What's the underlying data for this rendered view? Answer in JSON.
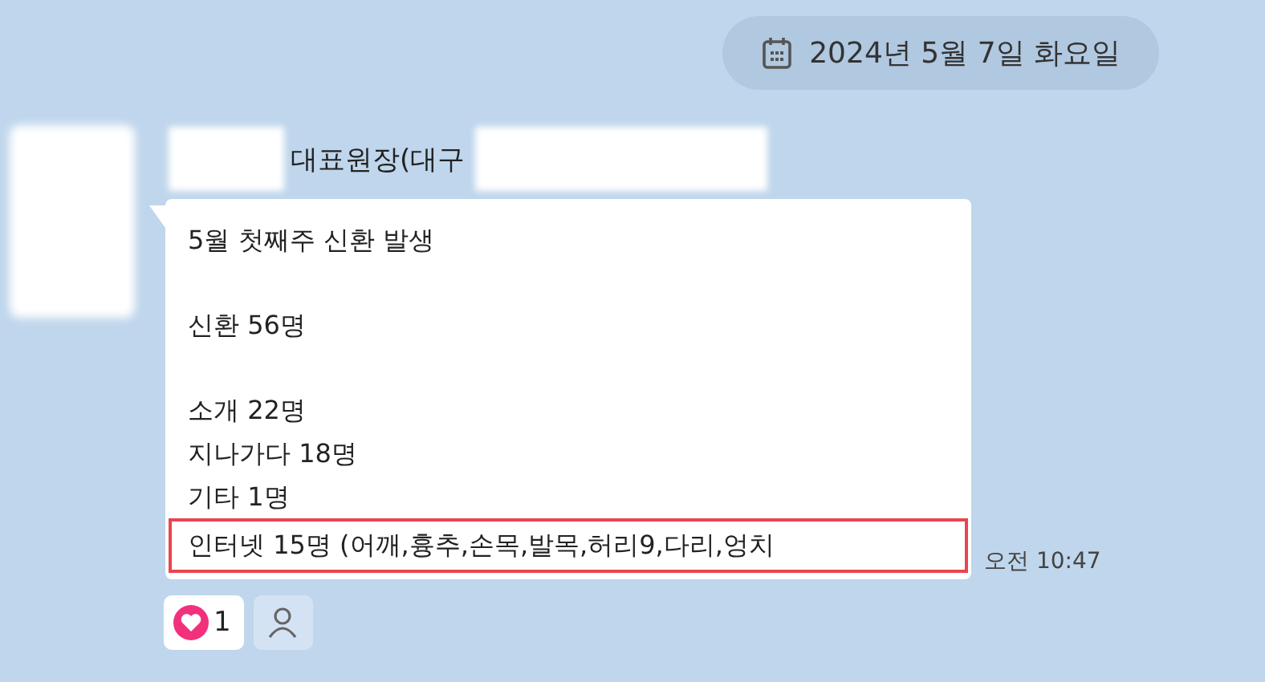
{
  "date_divider": {
    "text": "2024년 5월 7일 화요일"
  },
  "message": {
    "sender": "대표원장(대구",
    "paragraphs": [
      {
        "lines": [
          {
            "text": "5월 첫째주 신환 발생",
            "highlighted": false
          }
        ]
      },
      {
        "lines": [
          {
            "text": "신환 56명",
            "highlighted": false
          }
        ]
      },
      {
        "lines": [
          {
            "text": "소개 22명",
            "highlighted": false
          },
          {
            "text": "지나가다 18명",
            "highlighted": false
          },
          {
            "text": "기타 1명",
            "highlighted": false
          },
          {
            "text": "인터넷 15명 (어깨,흉추,손목,발목,허리9,다리,엉치",
            "highlighted": true
          }
        ]
      }
    ],
    "time": "오전 10:47",
    "reactions": [
      {
        "count": "1"
      }
    ]
  }
}
